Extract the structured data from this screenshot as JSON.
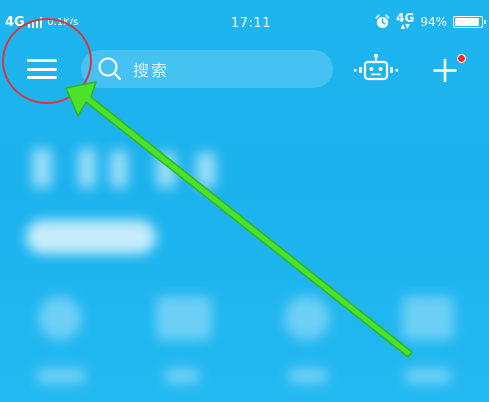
{
  "status_bar": {
    "network_label": "4G",
    "net_speed": "0.1K/s",
    "time": "17:11",
    "network_type": "4G",
    "battery_percent_label": "94%",
    "battery_level": 0.94
  },
  "top_bar": {
    "search_placeholder": "搜索",
    "icons": {
      "menu": "hamburger-menu-icon",
      "search": "search-icon",
      "robot": "robot-icon",
      "add": "plus-icon"
    },
    "add_has_notification": true
  },
  "colors": {
    "background": "#1db4ee",
    "foreground": "#ffffff",
    "notification_dot": "#ff2a2a",
    "annotation_circle": "#d9363e",
    "annotation_arrow": "#4be12d"
  }
}
